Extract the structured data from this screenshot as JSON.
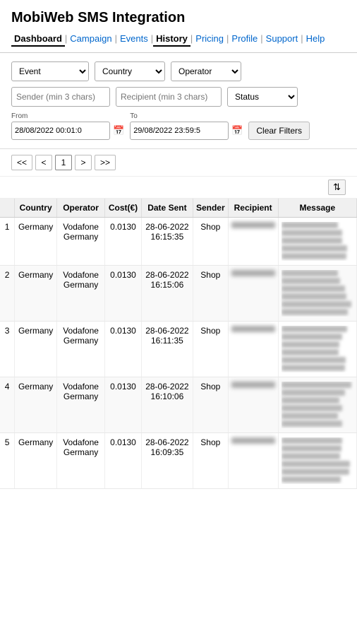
{
  "header": {
    "title": "MobiWeb SMS Integration",
    "nav": [
      {
        "label": "Dashboard",
        "active": false
      },
      {
        "label": "Campaign",
        "active": false
      },
      {
        "label": "Events",
        "active": false
      },
      {
        "label": "History",
        "active": true
      },
      {
        "label": "Pricing",
        "active": false
      },
      {
        "label": "Profile",
        "active": false
      },
      {
        "label": "Support",
        "active": false
      },
      {
        "label": "Help",
        "active": false
      }
    ]
  },
  "filters": {
    "event_placeholder": "Event",
    "country_placeholder": "Country",
    "operator_placeholder": "Operator",
    "sender_placeholder": "Sender (min 3 chars)",
    "recipient_placeholder": "Recipient (min 3 chars)",
    "status_placeholder": "Status",
    "from_label": "From",
    "to_label": "To",
    "from_value": "28/08/2022 00:01:0",
    "to_value": "29/08/2022 23:59:5",
    "clear_filters_label": "Clear Filters"
  },
  "pagination": {
    "first_label": "<<",
    "prev_label": "<",
    "current_page": "1",
    "next_label": ">",
    "last_label": ">>"
  },
  "table": {
    "columns": [
      "",
      "Country",
      "Operator",
      "Cost(€)",
      "Date Sent",
      "Sender",
      "Recipient",
      "Message"
    ],
    "rows": [
      {
        "num": "1",
        "country": "Germany",
        "operator": "Vodafone Germany",
        "cost": "0.0130",
        "date": "28-06-2022 16:15:35",
        "sender": "Shop",
        "recipient_blurred": true,
        "message": "Hello ████ ████ shipped. You view order s and estima delivery at"
      },
      {
        "num": "2",
        "country": "Germany",
        "operator": "Vodafone Germany",
        "cost": "0.0130",
        "date": "28-06-2022 16:15:06",
        "sender": "Shop",
        "recipient_blurred": true,
        "message": "Hello ████ thank you fo order ████. Y view order s and estima delivery at"
      },
      {
        "num": "3",
        "country": "Germany",
        "operator": "Vodafone Germany",
        "cost": "0.0130",
        "date": "28-06-2022 16:11:35",
        "sender": "Shop",
        "recipient_blurred": true,
        "message": "Hello ████████ order ████ shipped. You view order s and estima delivery at"
      },
      {
        "num": "4",
        "country": "Germany",
        "operator": "Vodafone Germany",
        "cost": "0.0130",
        "date": "28-06-2022 16:10:06",
        "sender": "Shop",
        "recipient_blurred": true,
        "message": "Hello ████ thank you fo order ████. Y view order s and estima delivery at"
      },
      {
        "num": "5",
        "country": "Germany",
        "operator": "Vodafone Germany",
        "cost": "0.0130",
        "date": "28-06-2022 16:09:35",
        "sender": "Shop",
        "recipient_blurred": true,
        "message": "Hello ████████ order ████ shipped. You view order s and estima delivery at"
      }
    ]
  }
}
